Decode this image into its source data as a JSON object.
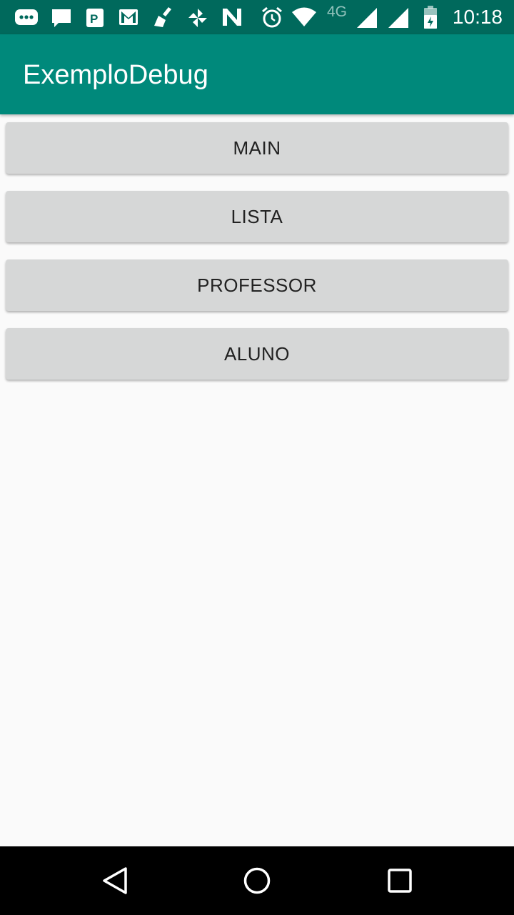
{
  "status_bar": {
    "time": "10:18",
    "network_label": "4G",
    "icons": [
      "messaging-icon",
      "chat-icon",
      "parking-icon",
      "gmail-icon",
      "cleaner-icon",
      "pinwheel-icon",
      "n-icon",
      "alarm-icon",
      "wifi-icon",
      "signal-icon",
      "signal-icon-2",
      "battery-icon"
    ]
  },
  "app_bar": {
    "title": "ExemploDebug",
    "color": "#00897b"
  },
  "buttons": [
    {
      "label": "MAIN"
    },
    {
      "label": "LISTA"
    },
    {
      "label": "PROFESSOR"
    },
    {
      "label": "ALUNO"
    }
  ],
  "nav_bar": {
    "icons": [
      "back-icon",
      "home-icon",
      "recents-icon"
    ]
  }
}
